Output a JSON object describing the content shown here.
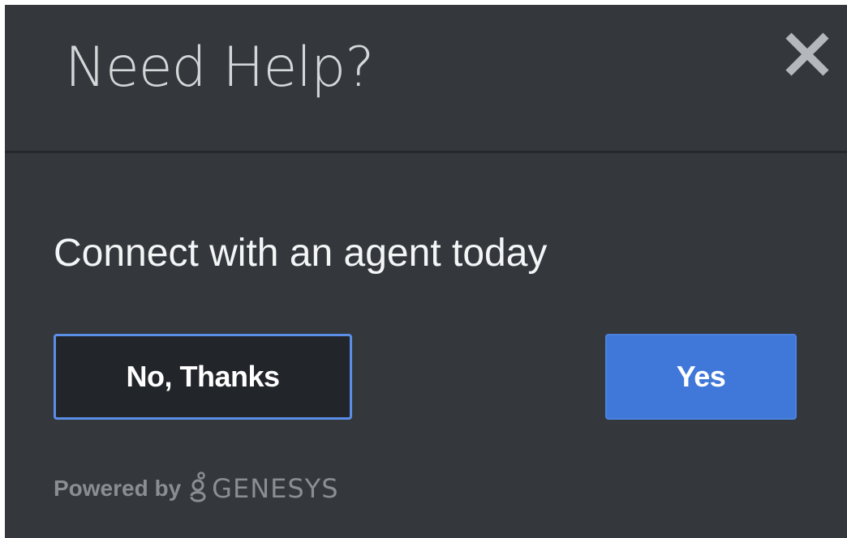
{
  "dialog": {
    "title": "Need Help?",
    "close_icon": "close-icon",
    "message": "Connect with an agent today",
    "buttons": {
      "no_label": "No, Thanks",
      "yes_label": "Yes"
    },
    "footer": {
      "powered_by": "Powered by",
      "brand_icon": "genesys-logo-icon",
      "brand_name": "GENESYS"
    }
  },
  "colors": {
    "background": "#34383d",
    "title": "#d4d6d8",
    "message": "#f4f5f6",
    "primary_button": "#3f78d9",
    "secondary_button_bg": "#22252a",
    "secondary_button_border": "#5b8ee6",
    "footer_text": "#8a8e93"
  }
}
